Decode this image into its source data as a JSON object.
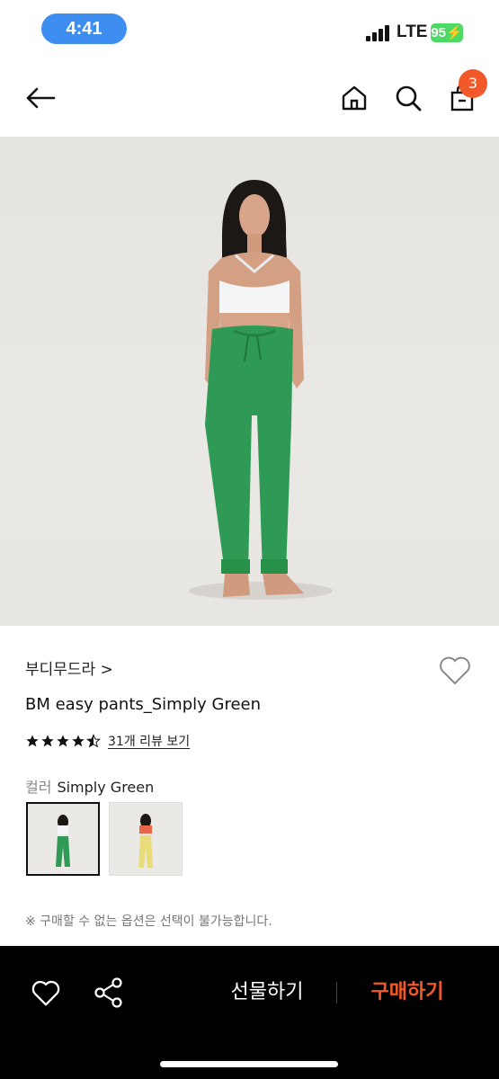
{
  "status": {
    "time": "4:41",
    "network": "LTE",
    "battery": "95"
  },
  "nav": {
    "cart_count": "3"
  },
  "product": {
    "brand": "부디무드라 >",
    "name": "BM easy pants_Simply Green",
    "rating": 4.5,
    "review_link": "31개 리뷰 보기",
    "color_label": "컬러",
    "color_value": "Simply Green",
    "notice": "※ 구매할 수 없는 옵션은 선택이 불가능합니다."
  },
  "bottom": {
    "gift_label": "선물하기",
    "buy_label": "구매하기"
  },
  "colors": {
    "accent": "#f2592a",
    "pants_green": "#2e9a55",
    "pants_yellow": "#e8dc78",
    "time_pill": "#3e8ef2",
    "battery": "#4cd964"
  }
}
